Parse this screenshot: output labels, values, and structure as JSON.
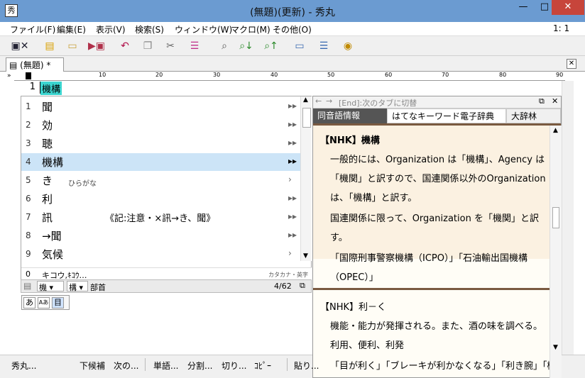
{
  "window": {
    "title": "(無題)(更新) - 秀丸",
    "icon_label": "秀",
    "min": "—",
    "max": "□",
    "close": "✕"
  },
  "menu": [
    "ファイル(F)",
    "編集(E)",
    "表示(V)",
    "検索(S)",
    "ウィンドウ(W)",
    "マクロ(M)",
    "その他(O)"
  ],
  "position_indicator": "1: 1",
  "toolbar_icons": [
    "save-close-icon",
    "new-file-icon",
    "open-folder-icon",
    "save-icon",
    "undo-icon",
    "copy-icon",
    "cut-icon",
    "paste-icon",
    "search-icon",
    "search-down-icon",
    "search-up-icon",
    "replace-icon",
    "split-window-icon",
    "help-icon"
  ],
  "tab": {
    "label": "(無題) *",
    "close": "✕"
  },
  "ruler_labels": [
    "10",
    "20",
    "30",
    "40",
    "50",
    "60",
    "70",
    "80",
    "90"
  ],
  "editor": {
    "line_number": "1",
    "selected_text": "機構"
  },
  "candidates": [
    {
      "num": "1",
      "text": "聞",
      "note": "",
      "arrow": "▸▸"
    },
    {
      "num": "2",
      "text": "効",
      "note": "",
      "arrow": "▸▸"
    },
    {
      "num": "3",
      "text": "聴",
      "note": "",
      "arrow": "▸▸"
    },
    {
      "num": "4",
      "text": "機構",
      "note": "",
      "arrow": "▸▸"
    },
    {
      "num": "5",
      "text": "き",
      "note": "ひらがな",
      "arrow": "›"
    },
    {
      "num": "6",
      "text": "利",
      "note": "",
      "arrow": "▸▸"
    },
    {
      "num": "7",
      "text": "訊",
      "note": "《記:注意・×訊→き、聞》",
      "arrow": "▸▸"
    },
    {
      "num": "8",
      "text": "→聞",
      "note": "",
      "arrow": "▸▸"
    },
    {
      "num": "9",
      "text": "気候",
      "note": "",
      "arrow": "›"
    }
  ],
  "candidate_zero": {
    "num": "0",
    "text": "キコウ,ｷｺｳ…",
    "note": "カタカナ・英字"
  },
  "candidate_footer": {
    "left1": "機",
    "left2": "構",
    "right_label": "部首",
    "page": "4/62"
  },
  "mode_buttons": [
    "あ",
    "Aあ",
    "目"
  ],
  "panel": {
    "nav_text": "[End]:次のタブに切替",
    "tabs": [
      "同音語情報",
      "はてなキーワード電子辞典",
      "大辞林"
    ],
    "entry1_title": "【NHK】機構",
    "entry1_lines": [
      "一般的には、Organization は「機構」、Agency は",
      "「機関」と訳すので、国連関係以外のOrganization",
      "は、「機構」と訳す。",
      "国連関係に限って、Organization を「機関」と訳",
      "す。",
      "「国際刑事警察機構（ICPO）」「石油輸出国機構",
      "（OPEC）」"
    ],
    "entry2_title": "【NHK】利－く",
    "entry2_lines": [
      "機能・能力が発揮される。また、酒の味を調べる。",
      "利用、便利、利発",
      "「目が利く」「ブレーキが利かなくなる」「利き腕」「機転が"
    ]
  },
  "status": [
    "秀丸...",
    "下候補",
    "次の...",
    "単語...",
    "分割...",
    "切り...",
    "ｺﾋﾟｰ",
    "貼り..."
  ]
}
